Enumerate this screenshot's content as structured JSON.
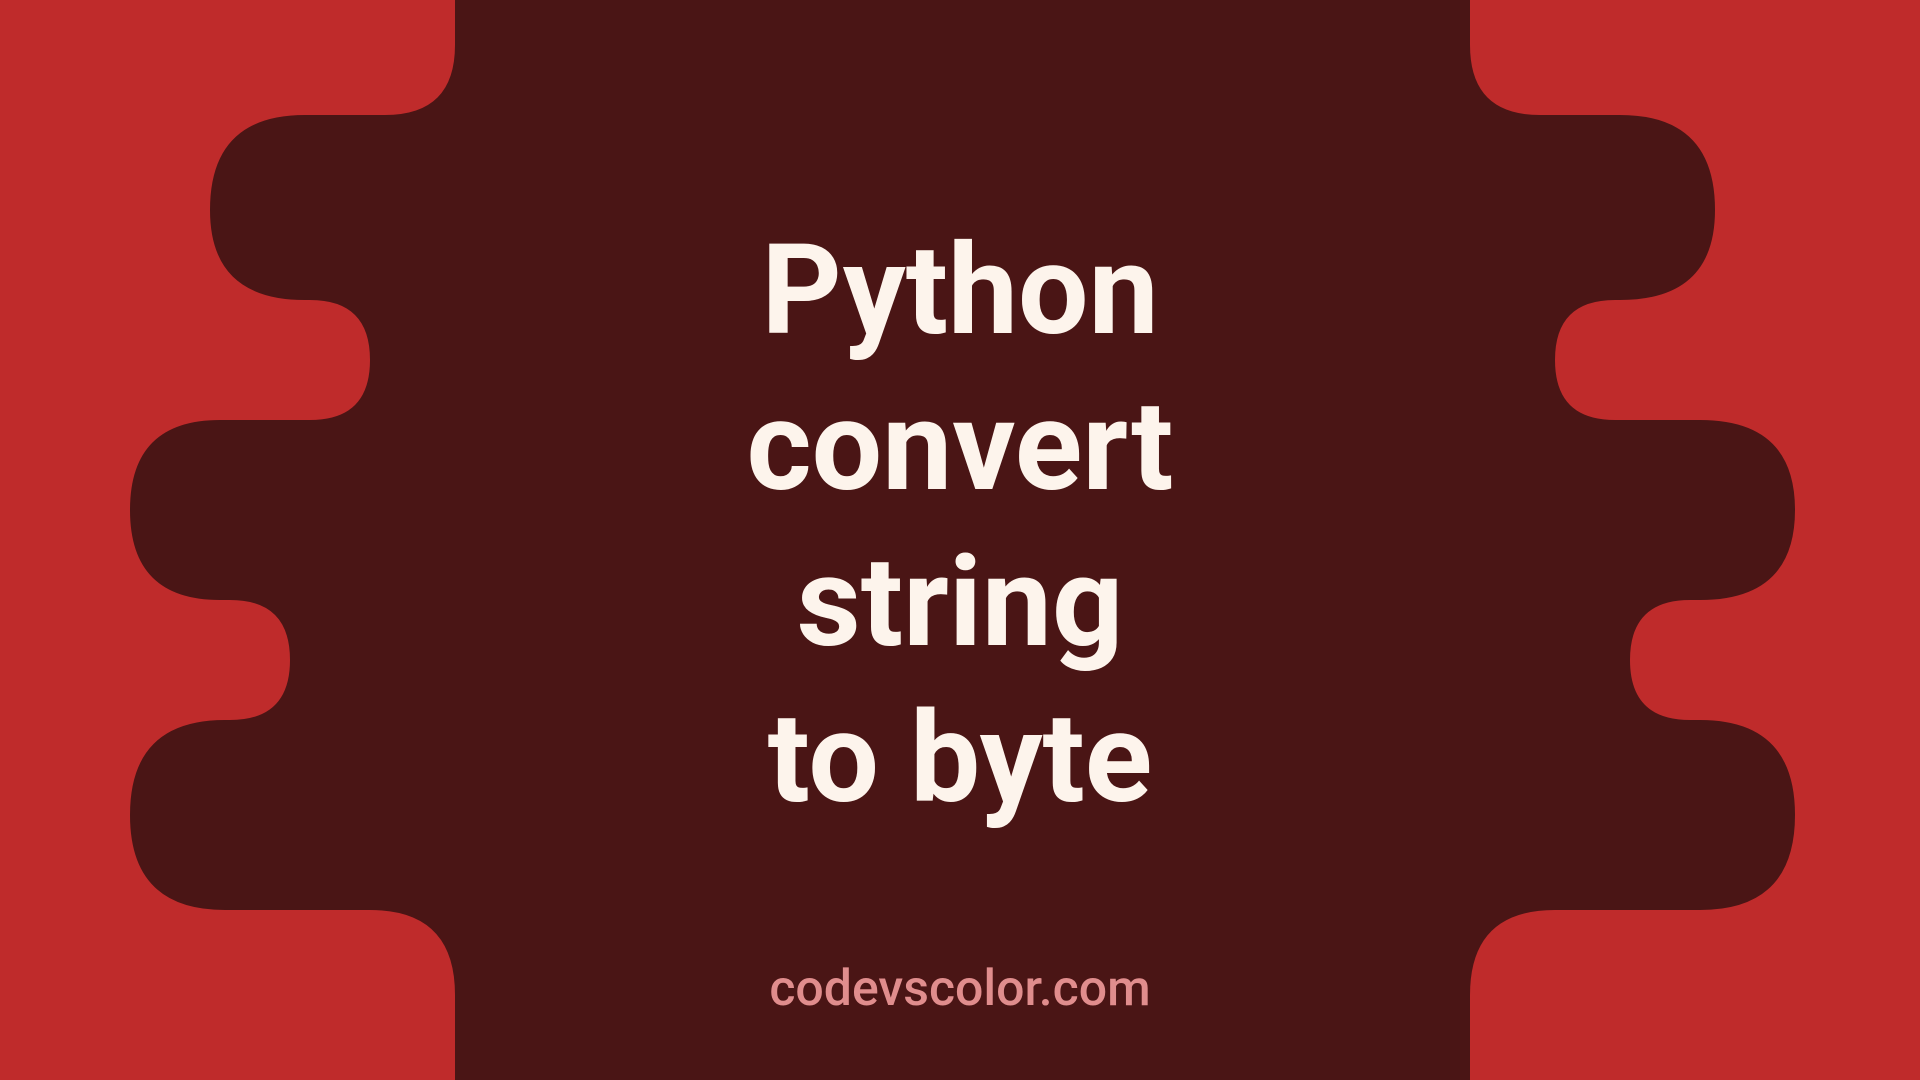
{
  "title_line1": "Python",
  "title_line2": "convert",
  "title_line3": "string",
  "title_line4": "to byte",
  "footer": "codevscolor.com",
  "colors": {
    "background": "#bf2b2b",
    "blob": "#4a1515",
    "text": "#fdf4ec",
    "footer": "#e08d8d"
  }
}
